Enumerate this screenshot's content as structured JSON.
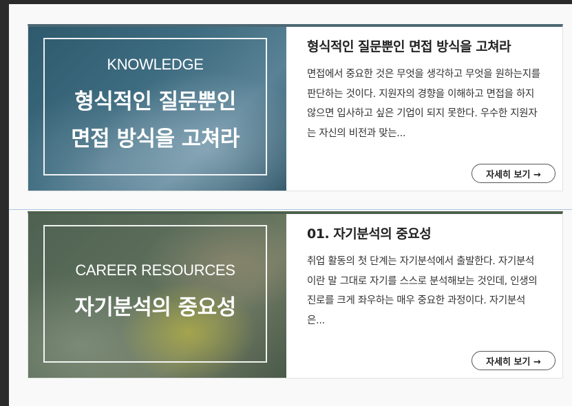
{
  "cards": [
    {
      "thumb_kicker": "KNOWLEDGE",
      "thumb_title_line1": "형식적인 질문뿐인",
      "thumb_title_line2": "면접 방식을 고쳐라",
      "title": "형식적인 질문뿐인 면접 방식을 고쳐라",
      "excerpt": "면접에서 중요한 것은 무엇을 생각하고 무엇을 원하는지를 판단하는 것이다. 지원자의 경향을 이해하고 면접을 하지 않으면 입사하고 싶은 기업이 되지 못한다. 우수한 지원자는 자신의 비전과 맞는...",
      "button_label": "자세히 보기 →"
    },
    {
      "thumb_kicker": "CAREER RESOURCES",
      "thumb_title_line1": "자기분석의 중요성",
      "title": "01. 자기분석의 중요성",
      "excerpt": "취업 활동의 첫 단계는 자기분석에서 출발한다. 자기분석이란 말 그대로 자기를 스스로 분석해보는 것인데, 인생의 진로를 크게 좌우하는 매우 중요한 과정이다. 자기분석은...",
      "button_label": "자세히 보기 →"
    }
  ]
}
